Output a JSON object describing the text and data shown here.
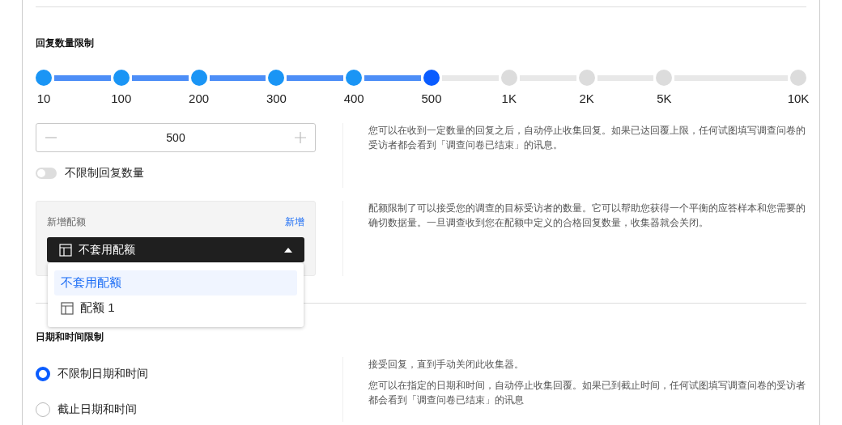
{
  "response_limit": {
    "title": "回复数量限制",
    "steps": [
      {
        "label": "10",
        "selected": false
      },
      {
        "label": "100",
        "selected": false
      },
      {
        "label": "200",
        "selected": false
      },
      {
        "label": "300",
        "selected": false
      },
      {
        "label": "400",
        "selected": false
      },
      {
        "label": "500",
        "selected": true
      },
      {
        "label": "1K",
        "selected": false
      },
      {
        "label": "2K",
        "selected": false
      },
      {
        "label": "5K",
        "selected": false
      },
      {
        "label": "10K",
        "selected": false
      }
    ],
    "stepper": {
      "value": "500"
    },
    "unlimited_toggle": {
      "label": "不限制回复数量",
      "on": false
    },
    "description": "您可以在收到一定数量的回复之后，自动停止收集回复。如果已达回覆上限，任何试图填写调查问卷的受访者都会看到「调查问卷已结束」的讯息。"
  },
  "quota": {
    "label": "新增配额",
    "add_link": "新增",
    "select": {
      "value": "不套用配额",
      "open": true
    },
    "options": [
      {
        "label": "不套用配额",
        "kind": "text",
        "selected": true
      },
      {
        "label": "配额 1",
        "kind": "table",
        "selected": false
      }
    ],
    "description": "配额限制了可以接受您的调查的目标受访者的数量。它可以帮助您获得一个平衡的应答样本和您需要的确切数据量。一旦调查收到您在配额中定义的合格回复数量，收集器就会关闭。"
  },
  "date_limit": {
    "title": "日期和时间限制",
    "options": [
      {
        "label": "不限制日期和时间",
        "selected": true
      },
      {
        "label": "截止日期和时间",
        "selected": false
      }
    ],
    "descriptions": [
      "接受回复，直到手动关闭此收集器。",
      "您可以在指定的日期和时间，自动停止收集回覆。如果已到截止时间，任何试图填写调查问卷的受访者都会看到「调查问卷已结束」的讯息"
    ]
  }
}
